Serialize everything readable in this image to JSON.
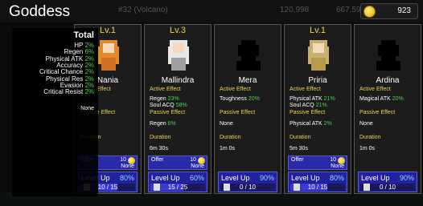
{
  "header": {
    "title": "Goddess",
    "stage": "#32 (Volcano)",
    "faded_value_1": "120,998",
    "faded_value_2": "667,594",
    "gold": "923"
  },
  "overlay": {
    "title": "Total",
    "stats": [
      {
        "label": "HP",
        "value": "2%"
      },
      {
        "label": "Regen",
        "value": "6%"
      },
      {
        "label": "Physical ATK",
        "value": "2%"
      },
      {
        "label": "Accuracy",
        "value": "2%"
      },
      {
        "label": "Critical Chance",
        "value": "2%"
      },
      {
        "label": "Physical Res",
        "value": "2%"
      },
      {
        "label": "Evasion",
        "value": "2%"
      },
      {
        "label": "Critical Resist",
        "value": "2%"
      }
    ],
    "passive": "None"
  },
  "cards": [
    {
      "name": "Nania",
      "level": "Lv.1",
      "active_label": "Active Effect",
      "passive_label": "Passive Effect",
      "duration_label": "Duration",
      "active": [],
      "passive": [],
      "duration": "",
      "offer_label": "Offer",
      "offer_count": "10",
      "offer_value": "None",
      "levelup_label": "Level Up",
      "levelup_pct": "80%",
      "progress": "10 / 15",
      "progress_frac": 0.67
    },
    {
      "name": "Mallindra",
      "level": "Lv.3",
      "active_label": "Active Effect",
      "passive_label": "Passive Effect",
      "duration_label": "Duration",
      "active": [
        {
          "text": "Regen ",
          "val": "23%"
        },
        {
          "text": "Soul ACQ ",
          "val": "58%"
        }
      ],
      "passive": [
        {
          "text": "Regen ",
          "val": "6%"
        }
      ],
      "duration": "6m 30s",
      "offer_label": "Offer",
      "offer_count": "10",
      "offer_value": "None",
      "levelup_label": "Level Up",
      "levelup_pct": "60%",
      "progress": "15 / 25",
      "progress_frac": 0.6
    },
    {
      "name": "Mera",
      "level": "",
      "active_label": "Active Effect",
      "passive_label": "Passive Effect",
      "duration_label": "Duration",
      "active": [
        {
          "text": "Toughness ",
          "val": "20%"
        }
      ],
      "passive": [
        {
          "text": "None",
          "val": ""
        }
      ],
      "duration": "1m 0s",
      "offer_label": "",
      "offer_count": "",
      "offer_value": "",
      "levelup_label": "Level Up",
      "levelup_pct": "90%",
      "progress": "0 / 10",
      "progress_frac": 0
    },
    {
      "name": "Priria",
      "level": "Lv.1",
      "active_label": "Active Effect",
      "passive_label": "Passive Effect",
      "duration_label": "Duration",
      "active": [
        {
          "text": "Physical ATK ",
          "val": "21%"
        },
        {
          "text": "Soul ACQ ",
          "val": "21%"
        }
      ],
      "passive": [
        {
          "text": "Physical ATK ",
          "val": "2%"
        }
      ],
      "duration": "5m 30s",
      "offer_label": "Offer",
      "offer_count": "10",
      "offer_value": "None",
      "levelup_label": "Level Up",
      "levelup_pct": "80%",
      "progress": "10 / 15",
      "progress_frac": 0.67
    },
    {
      "name": "Ardina",
      "level": "",
      "active_label": "Active Effect",
      "passive_label": "Passive Effect",
      "duration_label": "Duration",
      "active": [
        {
          "text": "Magical ATK ",
          "val": "20%"
        }
      ],
      "passive": [
        {
          "text": "None",
          "val": ""
        }
      ],
      "duration": "1m 0s",
      "offer_label": "",
      "offer_count": "",
      "offer_value": "",
      "levelup_label": "Level Up",
      "levelup_pct": "90%",
      "progress": "0 / 10",
      "progress_frac": 0
    }
  ],
  "colors": {
    "accent": "#f2d14a",
    "bonus": "#4cd14c",
    "button": "#2222a0"
  }
}
